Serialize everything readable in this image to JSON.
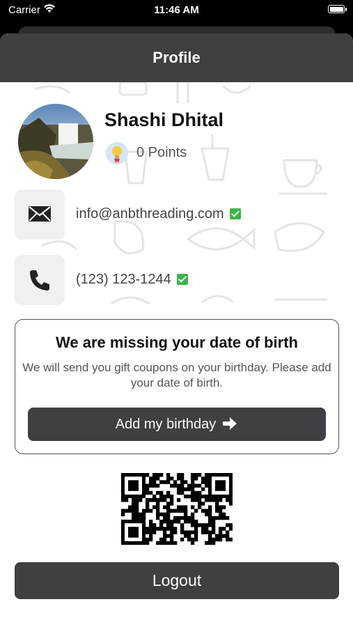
{
  "status_bar": {
    "carrier": "Carrier",
    "time": "11:46 AM"
  },
  "header": {
    "title": "Profile"
  },
  "profile": {
    "name": "Shashi Dhital",
    "points": "0 Points"
  },
  "contact": {
    "email": "info@anbthreading.com",
    "phone": "(123) 123-1244"
  },
  "birthday_card": {
    "title": "We are missing your date of birth",
    "description": "We will send you gift coupons on your birthday. Please add your date of birth.",
    "button_label": "Add my birthday"
  },
  "logout_label": "Logout"
}
